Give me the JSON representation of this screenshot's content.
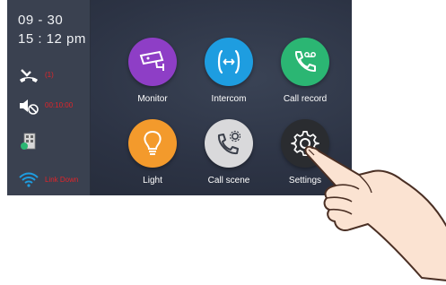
{
  "status_bar": {
    "date": "09 - 30",
    "time": "15 : 12 pm",
    "missed_calls_value": "(1)",
    "mute_label": "00:10:00",
    "network_label": "Link Down"
  },
  "apps": [
    {
      "label": "Monitor",
      "icon": "cctv-camera-icon",
      "color": "#8e3ec6"
    },
    {
      "label": "Intercom",
      "icon": "intercom-phone-icon",
      "color": "#1e9de0"
    },
    {
      "label": "Call record",
      "icon": "voicemail-phone-icon",
      "color": "#2bb673"
    },
    {
      "label": "Light",
      "icon": "lightbulb-icon",
      "color": "#f39a2c"
    },
    {
      "label": "Call scene",
      "icon": "phone-settings-icon",
      "color": "#d9d9db"
    },
    {
      "label": "Settings",
      "icon": "gear-icon",
      "color": "#2a2c30"
    }
  ],
  "colors": {
    "screen_bg": "#2b3243",
    "sidebar_bg": "#3a4150",
    "status_red": "#e0252a",
    "wifi_blue": "#1e9de0"
  }
}
